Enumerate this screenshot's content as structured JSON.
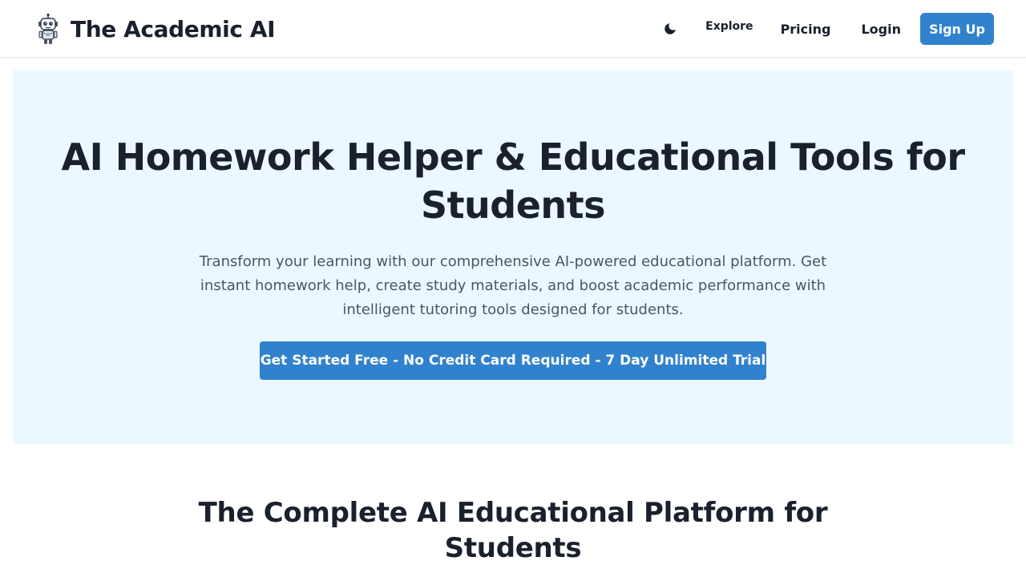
{
  "header": {
    "brand_title": "The Academic AI",
    "logo_icon": "robot-icon",
    "theme_toggle_icon": "moon-icon",
    "nav": {
      "explore": "Explore",
      "pricing": "Pricing",
      "login": "Login",
      "signup": "Sign Up"
    }
  },
  "hero": {
    "title": "AI Homework Helper & Educational Tools for Students",
    "subtitle": "Transform your learning with our comprehensive AI-powered educational platform. Get instant homework help, create study materials, and boost academic performance with intelligent tutoring tools designed for students.",
    "cta": "Get Started Free - No Credit Card Required - 7 Day Unlimited Trial"
  },
  "section": {
    "title": "The Complete AI Educational Platform for Students"
  },
  "colors": {
    "accent": "#3182ce",
    "hero_background": "#ebf8ff",
    "text_dark": "#1a202c",
    "text_muted": "#4a5568"
  }
}
